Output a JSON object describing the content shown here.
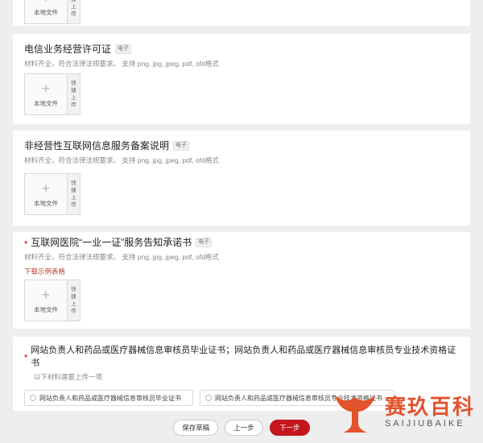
{
  "top_partial": {
    "upload_label": "本地文件",
    "quick_label": "快捷上传"
  },
  "sections": [
    {
      "title": "电信业务经营许可证",
      "tag": "电子",
      "hint": "材料齐全，符合法律法规要求。  支持 png, jpg, jpeg, pdf, ofd格式",
      "upload_label": "本地文件",
      "quick_label": "快捷上传"
    },
    {
      "title": "非经营性互联网信息服务备案说明",
      "tag": "电子",
      "hint": "材料齐全，符合法律法规要求。  支持 png, jpg, jpeg, pdf, ofd格式",
      "upload_label": "本地文件",
      "quick_label": "快捷上传"
    },
    {
      "required_mark": "•",
      "title": "互联网医院“一业一证”服务告知承诺书",
      "tag": "电子",
      "hint": "材料齐全，符合法律法规要求。  支持 png, jpg, jpeg, pdf, ofd格式",
      "link": "下载示例表格",
      "upload_label": "本地文件",
      "quick_label": "快捷上传"
    }
  ],
  "choice_section": {
    "required_mark": "•",
    "title": "网站负责人和药品或医疗器械信息审核员毕业证书；网站负责人和药品或医疗器械信息审核员专业技术资格证书",
    "subtitle": "以下材料需要上传一项",
    "options": [
      "网站负责人和药品或医疗器械信息审核员毕业证书",
      "网站负责人和药品或医疗器械信息审核员专业技术资格证书"
    ]
  },
  "footer": {
    "save_label": "保存草稿",
    "prev_label": "上一步",
    "next_label": "下一步"
  },
  "brand": {
    "name_cn": "赛玖百科",
    "name_en": "SAIJIUBAIKE",
    "color": "#e2522b"
  },
  "colors": {
    "accent": "#c4161c",
    "required": "#e23a2e"
  }
}
